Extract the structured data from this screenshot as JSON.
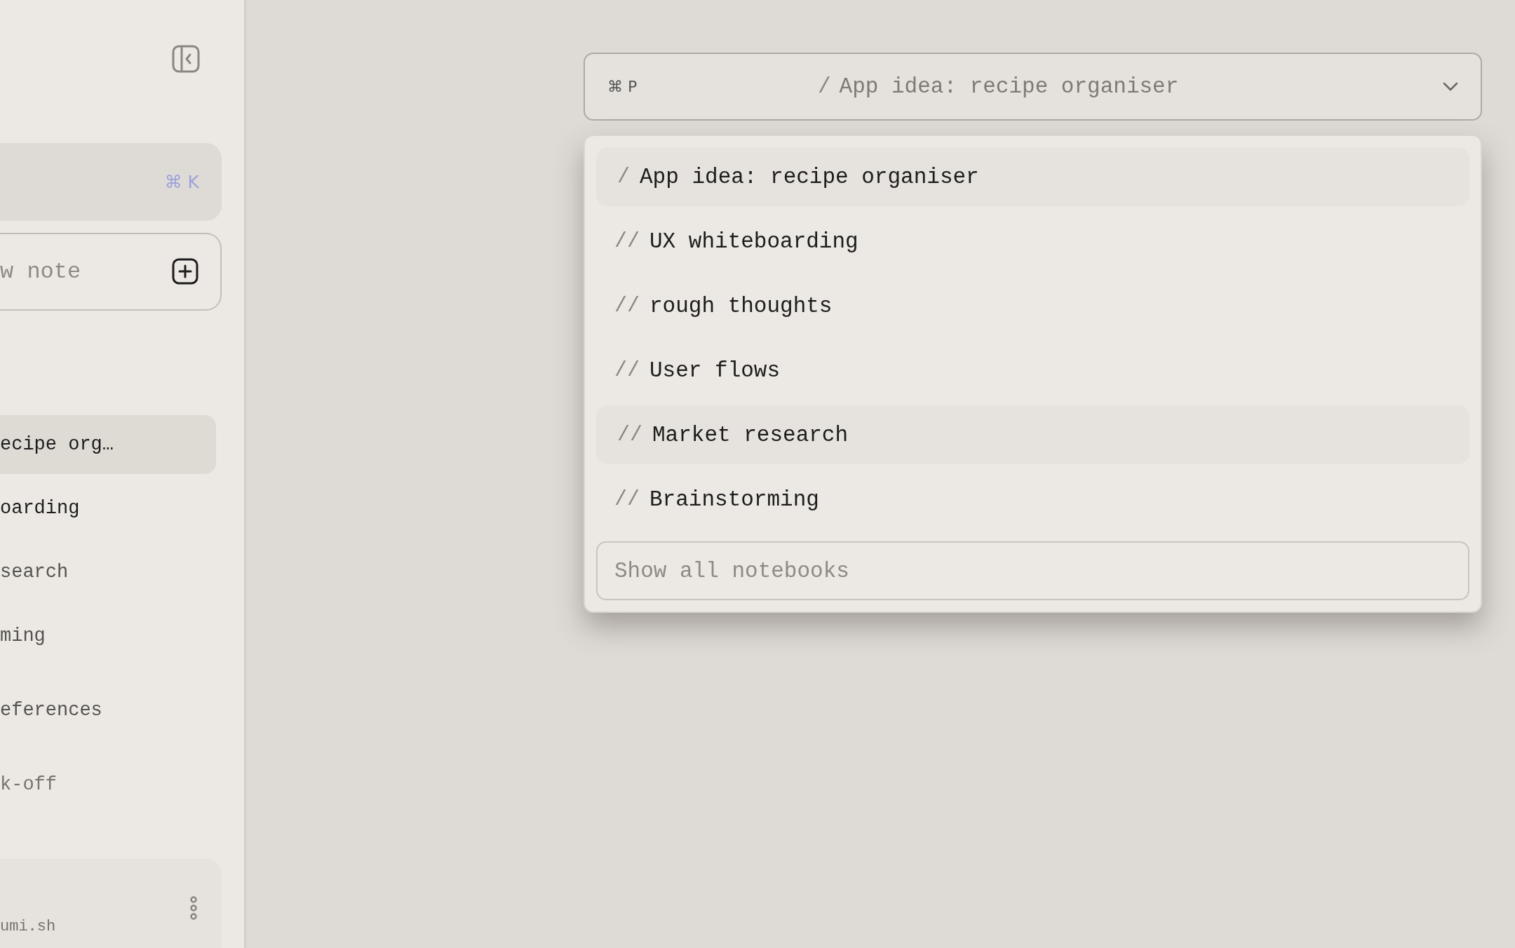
{
  "sidebar": {
    "search": {
      "shortcut": "⌘ K"
    },
    "new_note": {
      "placeholder": "w note"
    },
    "notes": [
      {
        "title": "ecipe org…",
        "selected": true,
        "kind": "active"
      },
      {
        "title": "oarding",
        "selected": false,
        "kind": "active"
      },
      {
        "title": "search",
        "selected": false,
        "kind": "muted"
      },
      {
        "title": "ming",
        "selected": false,
        "kind": "muted"
      },
      {
        "title": "eferences",
        "selected": false,
        "kind": "muted"
      },
      {
        "title": "k-off",
        "selected": false,
        "kind": "faint"
      }
    ],
    "account": {
      "domain": "umi.sh"
    }
  },
  "notebook_picker": {
    "shortcut": "⌘ P",
    "prefix": "/",
    "current": "App idea: recipe organiser"
  },
  "dropdown": {
    "items": [
      {
        "prefix": "/",
        "label": "App idea: recipe organiser",
        "highlighted": true
      },
      {
        "prefix": "//",
        "label": "UX whiteboarding",
        "highlighted": false
      },
      {
        "prefix": "//",
        "label": "rough thoughts",
        "highlighted": false
      },
      {
        "prefix": "//",
        "label": "User flows",
        "highlighted": false
      },
      {
        "prefix": "//",
        "label": "Market research",
        "highlighted": true
      },
      {
        "prefix": "//",
        "label": "Brainstorming",
        "highlighted": false
      }
    ],
    "show_all": {
      "placeholder": "Show all notebooks"
    }
  }
}
